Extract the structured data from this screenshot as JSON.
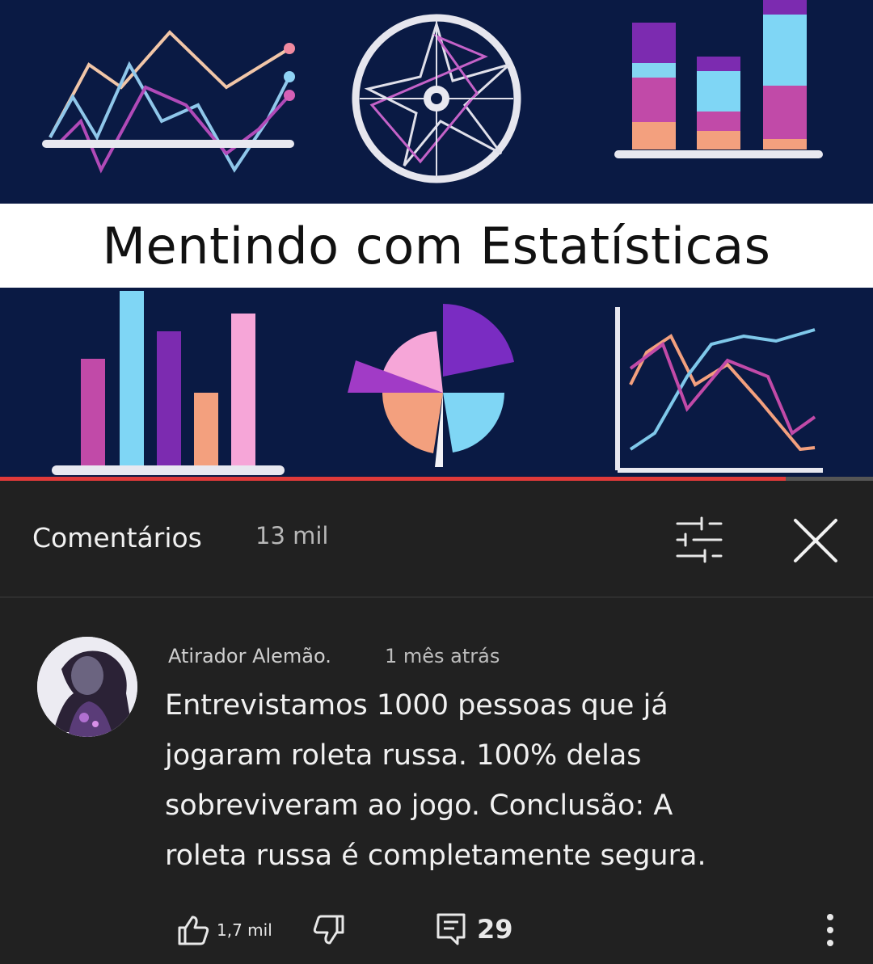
{
  "thumbnail": {
    "title": "Mentindo com Estatísticas",
    "progress_fraction": 0.9
  },
  "comments_panel": {
    "title": "Comentários",
    "count": "13 mil"
  },
  "comment": {
    "author": "Atirador Alemão.",
    "timestamp": "1 mês atrás",
    "text_lines": [
      "Entrevistamos 1000 pessoas que já",
      "jogaram roleta russa. 100% delas",
      "sobreviveram ao jogo. Conclusão: A",
      "roleta russa é completamente segura."
    ],
    "likes": "1,7 mil",
    "replies": "29"
  },
  "icons": {
    "sort": "sort-filter-icon",
    "close": "close-icon",
    "like": "thumbs-up-icon",
    "dislike": "thumbs-down-icon",
    "reply": "comment-reply-icon",
    "more": "more-vertical-icon"
  },
  "colors": {
    "panel_bg": "#212121",
    "thumb_bg": "#0a1a44",
    "progress": "#e03a3a"
  }
}
